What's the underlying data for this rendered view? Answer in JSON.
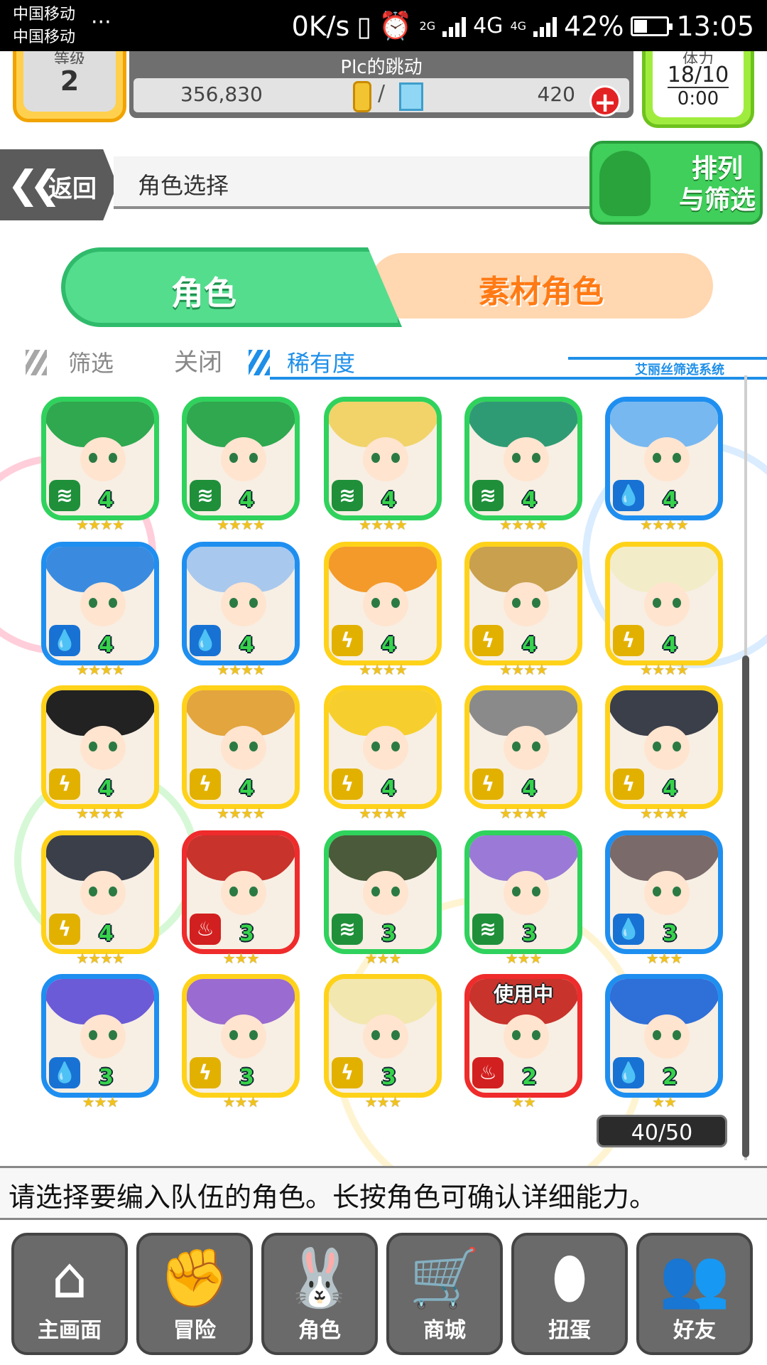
{
  "status_bar": {
    "carrier_1": "中国移动",
    "carrier_2": "中国移动",
    "dots": "···",
    "net_speed": "0K/s",
    "net_2g": "2G",
    "net_4g_a": "4G",
    "net_4g_b": "4G",
    "battery": "42%",
    "battery_level": 0.42,
    "time": "13:05"
  },
  "header": {
    "level_label": "等级",
    "level_value": "2",
    "player_name": "Plc的跳动",
    "coins": "356,830",
    "gems": "420",
    "coin_gem_separator": "/",
    "add_symbol": "+",
    "stamina_label": "体力",
    "stamina_value": "18/10",
    "stamina_timer": "0:00"
  },
  "nav": {
    "back_label": "返回",
    "page_title": "角色选择",
    "sort_filter_label": "排列\n与筛选"
  },
  "tabs": {
    "character": "角色",
    "material": "素材角色"
  },
  "filter": {
    "filter_label": "筛选",
    "filter_state": "关闭",
    "sort_label": "稀有度",
    "system_label": "艾丽丝筛选系统"
  },
  "characters": [
    {
      "element": "wind",
      "level": "4",
      "stars": 4,
      "frame": "green",
      "hair": "#2fa84f"
    },
    {
      "element": "wind",
      "level": "4",
      "stars": 4,
      "frame": "green",
      "hair": "#2fa84f"
    },
    {
      "element": "wind",
      "level": "4",
      "stars": 4,
      "frame": "green",
      "hair": "#f1d36a"
    },
    {
      "element": "wind",
      "level": "4",
      "stars": 4,
      "frame": "green",
      "hair": "#2f9b74"
    },
    {
      "element": "water",
      "level": "4",
      "stars": 4,
      "frame": "blue",
      "hair": "#78b8f0"
    },
    {
      "element": "water",
      "level": "4",
      "stars": 4,
      "frame": "blue",
      "hair": "#3a8be0"
    },
    {
      "element": "water",
      "level": "4",
      "stars": 4,
      "frame": "blue",
      "hair": "#a9c8ee"
    },
    {
      "element": "thunder",
      "level": "4",
      "stars": 4,
      "frame": "yellow",
      "hair": "#f39a2a"
    },
    {
      "element": "thunder",
      "level": "4",
      "stars": 4,
      "frame": "yellow",
      "hair": "#c9a04e"
    },
    {
      "element": "thunder",
      "level": "4",
      "stars": 4,
      "frame": "yellow",
      "hair": "#f3ecc8"
    },
    {
      "element": "thunder",
      "level": "4",
      "stars": 4,
      "frame": "yellow",
      "hair": "#222222"
    },
    {
      "element": "thunder",
      "level": "4",
      "stars": 4,
      "frame": "yellow",
      "hair": "#e3a53e"
    },
    {
      "element": "thunder",
      "level": "4",
      "stars": 4,
      "frame": "yellow",
      "hair": "#f6cf2e"
    },
    {
      "element": "thunder",
      "level": "4",
      "stars": 4,
      "frame": "yellow",
      "hair": "#8a8a8a"
    },
    {
      "element": "thunder",
      "level": "4",
      "stars": 4,
      "frame": "yellow",
      "hair": "#3a3f4a"
    },
    {
      "element": "thunder",
      "level": "4",
      "stars": 4,
      "frame": "yellow",
      "hair": "#3a3f4a"
    },
    {
      "element": "fire",
      "level": "3",
      "stars": 3,
      "frame": "red",
      "hair": "#c8332c"
    },
    {
      "element": "wind",
      "level": "3",
      "stars": 3,
      "frame": "green",
      "hair": "#4a5a3a"
    },
    {
      "element": "wind",
      "level": "3",
      "stars": 3,
      "frame": "green",
      "hair": "#9a7ad6"
    },
    {
      "element": "water",
      "level": "3",
      "stars": 3,
      "frame": "blue",
      "hair": "#7a6a6a"
    },
    {
      "element": "water",
      "level": "3",
      "stars": 3,
      "frame": "blue",
      "hair": "#6b5bd6"
    },
    {
      "element": "thunder",
      "level": "3",
      "stars": 3,
      "frame": "yellow",
      "hair": "#9a6bd0"
    },
    {
      "element": "thunder",
      "level": "3",
      "stars": 3,
      "frame": "yellow",
      "hair": "#f3e7b0"
    },
    {
      "element": "fire",
      "level": "2",
      "stars": 2,
      "frame": "red",
      "hair": "#c8332c",
      "badge": "使用中"
    },
    {
      "element": "water",
      "level": "2",
      "stars": 2,
      "frame": "blue",
      "hair": "#2f6fd8"
    }
  ],
  "element_icons": {
    "wind": "wind-icon",
    "water": "water-icon",
    "thunder": "thunder-icon",
    "fire": "fire-icon"
  },
  "frame_colors": {
    "green": "#2fd25c",
    "blue": "#1e8ff0",
    "yellow": "#ffd21a",
    "red": "#ef2b2b"
  },
  "element_colors": {
    "wind": "#1f8f3a",
    "water": "#1772d4",
    "thunder": "#e2b100",
    "fire": "#d21f1f"
  },
  "count_label": "40/50",
  "hint_text": "请选择要编入队伍的角色。长按角色可确认详细能力。",
  "bottom_nav": [
    {
      "label": "主画面",
      "icon": "home-icon"
    },
    {
      "label": "冒险",
      "icon": "handshake-icon"
    },
    {
      "label": "角色",
      "icon": "bunny-icon"
    },
    {
      "label": "商城",
      "icon": "cart-icon"
    },
    {
      "label": "扭蛋",
      "icon": "egg-icon"
    },
    {
      "label": "好友",
      "icon": "friends-icon"
    }
  ]
}
